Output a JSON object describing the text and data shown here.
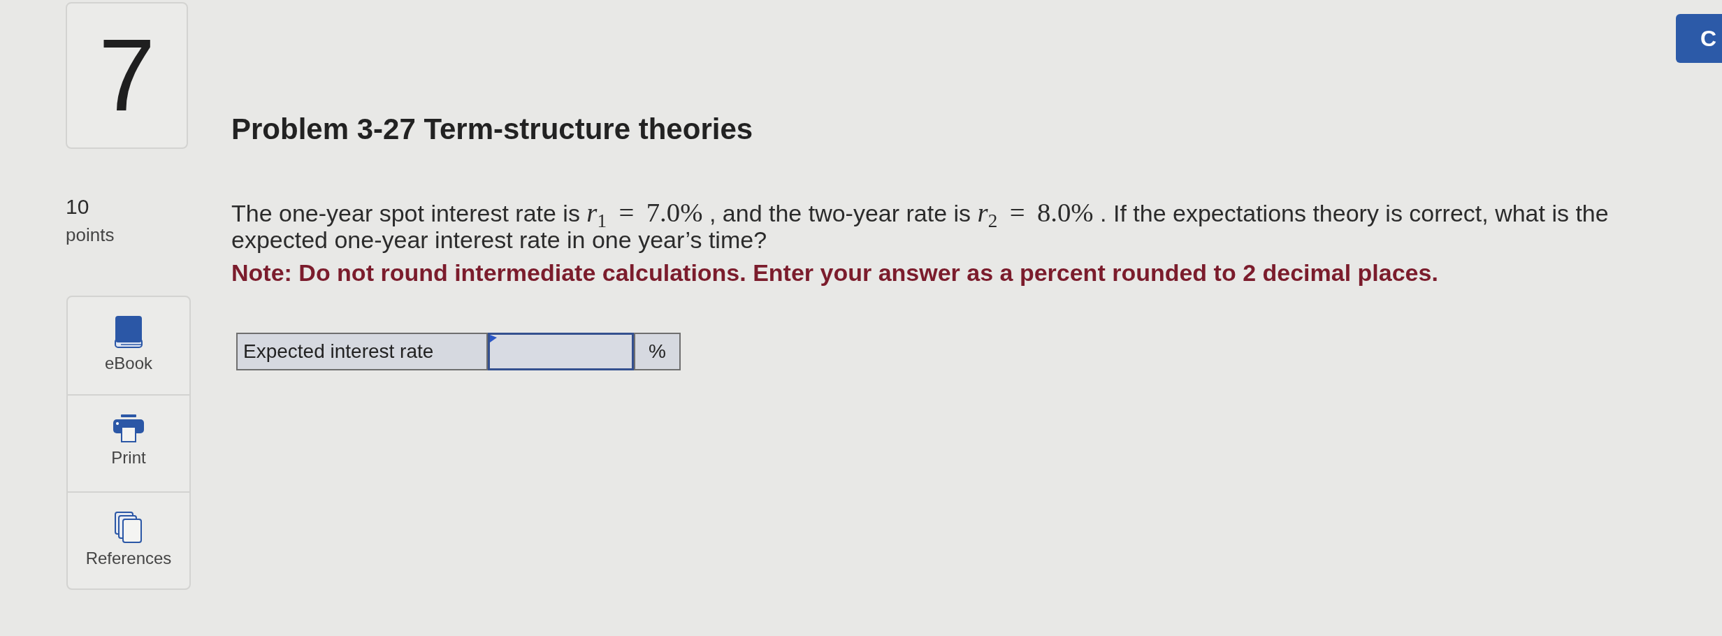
{
  "question_number": {
    "label": "7"
  },
  "header_button": {
    "label": "C"
  },
  "title": "Problem 3-27 Term-structure theories",
  "points": {
    "value": "10",
    "unit": "points"
  },
  "tools": [
    {
      "kind": "ebook",
      "label": "eBook"
    },
    {
      "kind": "print",
      "label": "Print"
    },
    {
      "kind": "references",
      "label": "References"
    }
  ],
  "question": {
    "parts": [
      {
        "kind": "text",
        "text": "The one-year spot interest rate is "
      },
      {
        "kind": "math",
        "text": "*r*$_{1}$ = 7.0%"
      },
      {
        "kind": "text",
        "text": " , and the two-year rate is "
      },
      {
        "kind": "math",
        "text": "*r*$_{2}$ = 8.0%"
      },
      {
        "kind": "text",
        "text": " . If the expectations theory is correct, what is the expected one-year interest rate in one year’s time?"
      }
    ]
  },
  "note": "Note: Do not round intermediate calculations. Enter your answer as a percent rounded to 2 decimal places.",
  "answer_table": {
    "rows": [
      {
        "label": "Expected interest rate",
        "unit": "%"
      }
    ]
  }
}
